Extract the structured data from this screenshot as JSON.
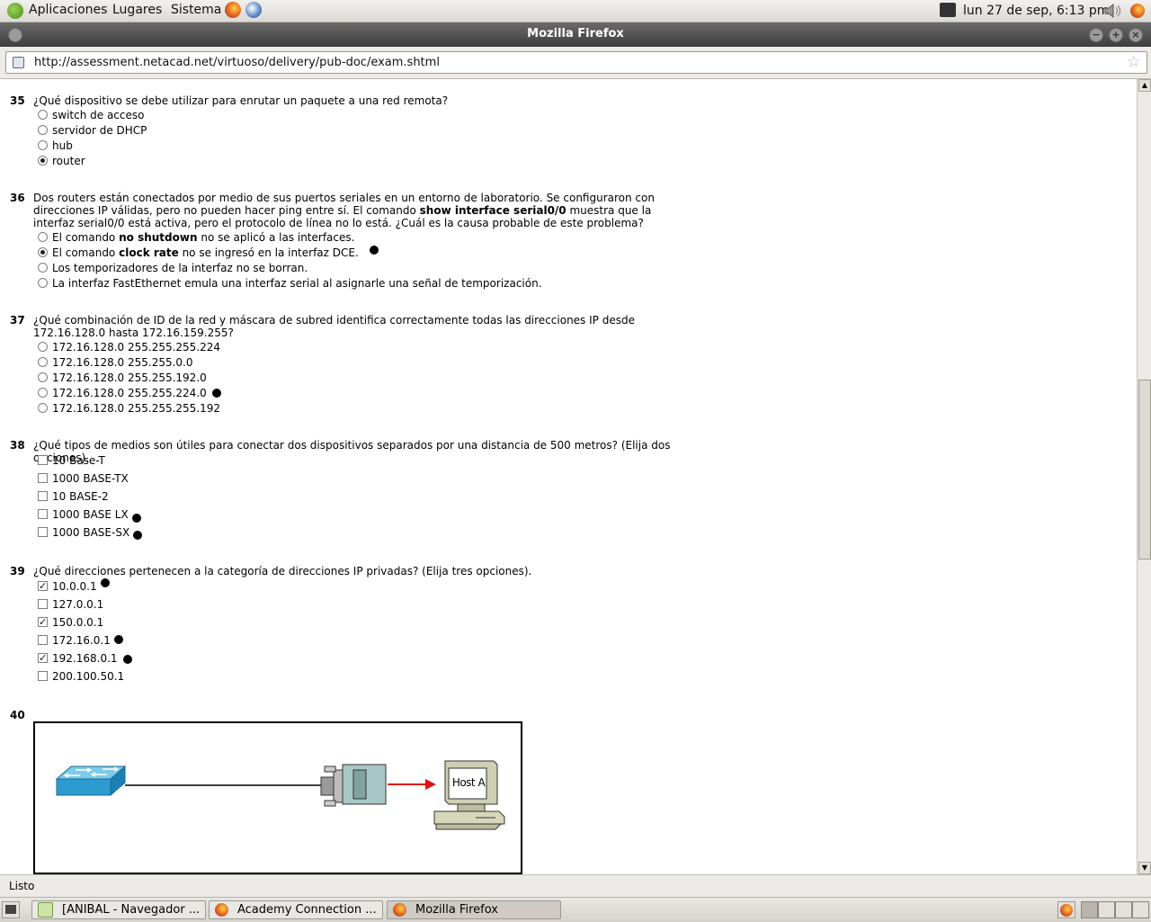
{
  "top_panel": {
    "menus": [
      "Aplicaciones",
      "Lugares",
      "Sistema"
    ],
    "clock": "lun 27 de sep,  6:13 pm"
  },
  "window": {
    "title": "Mozilla Firefox"
  },
  "navbar": {
    "url": "http://assessment.netacad.net/virtuoso/delivery/pub-doc/exam.shtml"
  },
  "questions": {
    "q35": {
      "number": "35",
      "text": "¿Qué dispositivo se debe utilizar para enrutar un paquete a una red remota?",
      "options": [
        "switch de acceso",
        "servidor de DHCP",
        "hub",
        "router"
      ]
    },
    "q36": {
      "number": "36",
      "text_a": "Dos routers están conectados por medio de sus puertos seriales en un entorno de laboratorio. Se configuraron con direcciones IP válidas, pero no pueden hacer ping entre sí. El comando ",
      "text_bold": "show interface serial0/0",
      "text_b": " muestra que la interfaz serial0/0 está activa, pero el protocolo de línea no lo está. ¿Cuál es la causa probable de este problema?",
      "opt1_a": "El comando ",
      "opt1_bold": "no shutdown",
      "opt1_b": " no se aplicó a las interfaces.",
      "opt2_a": "El comando ",
      "opt2_bold": "clock rate",
      "opt2_b": " no se ingresó en la interfaz DCE.",
      "opt3": "Los temporizadores de la interfaz no se borran.",
      "opt4": "La interfaz FastEthernet emula una interfaz serial al asignarle una señal de temporización."
    },
    "q37": {
      "number": "37",
      "text": "¿Qué combinación de ID de la red y máscara de subred identifica correctamente todas las direcciones IP desde 172.16.128.0 hasta 172.16.159.255?",
      "options": [
        "172.16.128.0 255.255.255.224",
        "172.16.128.0 255.255.0.0",
        "172.16.128.0 255.255.192.0",
        "172.16.128.0 255.255.224.0",
        "172.16.128.0 255.255.255.192"
      ]
    },
    "q38": {
      "number": "38",
      "text": "¿Qué tipos de medios son útiles para conectar dos dispositivos separados por una distancia de 500 metros? (Elija dos opciones).",
      "options": [
        "10 Base-T",
        "1000 BASE-TX",
        "10 BASE-2",
        "1000 BASE LX",
        "1000 BASE-SX"
      ]
    },
    "q39": {
      "number": "39",
      "text": "¿Qué direcciones pertenecen a la categoría de direcciones IP privadas? (Elija tres opciones).",
      "options": [
        "10.0.0.1",
        "127.0.0.1",
        "150.0.0.1",
        "172.16.0.1",
        "192.168.0.1",
        "200.100.50.1"
      ]
    },
    "q40": {
      "number": "40",
      "diagram_label": "Host A"
    }
  },
  "statusbar": {
    "text": "Listo"
  },
  "taskbar": {
    "tasks": [
      "[ANIBAL - Navegador ...",
      "Academy Connection ...",
      "Mozilla Firefox"
    ]
  }
}
